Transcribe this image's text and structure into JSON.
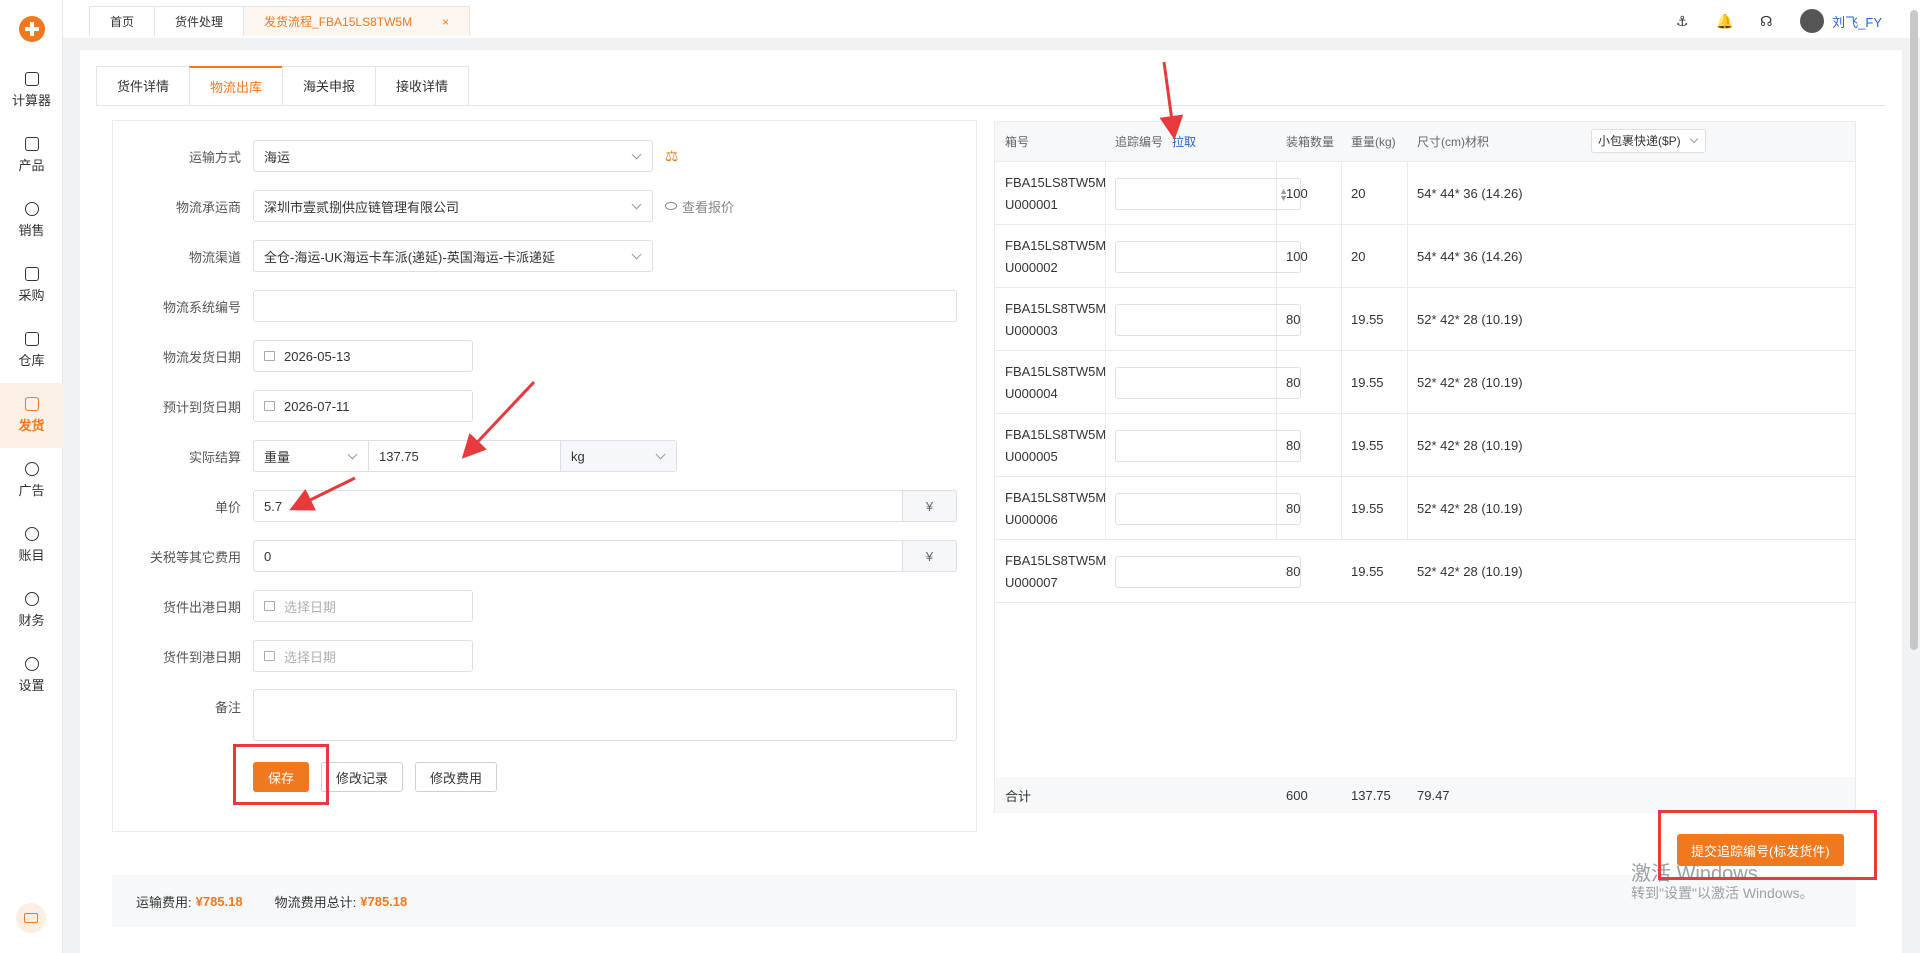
{
  "sidebar": {
    "items": [
      {
        "label": "计算器",
        "icon": "calculator-icon"
      },
      {
        "label": "产品",
        "icon": "inbox-icon"
      },
      {
        "label": "销售",
        "icon": "chart-icon"
      },
      {
        "label": "采购",
        "icon": "basket-icon"
      },
      {
        "label": "仓库",
        "icon": "warehouse-icon"
      },
      {
        "label": "发货",
        "icon": "person-ship-icon"
      },
      {
        "label": "广告",
        "icon": "ad-icon"
      },
      {
        "label": "账目",
        "icon": "yen-icon"
      },
      {
        "label": "财务",
        "icon": "yen-circle-icon"
      },
      {
        "label": "设置",
        "icon": "gear-icon"
      }
    ],
    "active": "发货"
  },
  "top_tabs": [
    {
      "label": "首页"
    },
    {
      "label": "货件处理"
    },
    {
      "label": "发货流程_FBA15LS8TW5M",
      "close": "×"
    }
  ],
  "user": {
    "name": "刘飞_FY"
  },
  "sub_tabs": [
    "货件详情",
    "物流出库",
    "海关申报",
    "接收详情"
  ],
  "form": {
    "transport_label": "运输方式",
    "transport_value": "海运",
    "carrier_label": "物流承运商",
    "carrier_value": "深圳市壹贰捌供应链管理有限公司",
    "carrier_link": "查看报价",
    "channel_label": "物流渠道",
    "channel_value": "全仓-海运-UK海运卡车派(递延)-英国海运-卡派递延",
    "sysno_label": "物流系统编号",
    "sysno_value": "",
    "ship_date_label": "物流发货日期",
    "ship_date_value": "2026-05-13",
    "eta_label": "预计到货日期",
    "eta_value": "2026-07-11",
    "settle_label": "实际结算",
    "settle_type": "重量",
    "settle_value": "137.75",
    "settle_unit": "kg",
    "price_label": "单价",
    "price_value": "5.7",
    "currency": "¥",
    "tax_label": "关税等其它费用",
    "tax_value": "0",
    "depart_label": "货件出港日期",
    "arrive_label": "货件到港日期",
    "date_placeholder": "选择日期",
    "remark_label": "备注",
    "save_btn": "保存",
    "history_btn": "修改记录",
    "edit_fee_btn": "修改费用"
  },
  "table": {
    "headers": {
      "box": "箱号",
      "track": "追踪编号",
      "pull": "拉取",
      "qty": "装箱数量",
      "weight": "重量(kg)",
      "size": "尺寸(cm)材积"
    },
    "size_select": "小包裹快递($P)",
    "rows": [
      {
        "box1": "FBA15LS8TW5M",
        "box2": "U000001",
        "qty": "100",
        "weight": "20",
        "size": "54* 44* 36 (14.26)"
      },
      {
        "box1": "FBA15LS8TW5M",
        "box2": "U000002",
        "qty": "100",
        "weight": "20",
        "size": "54* 44* 36 (14.26)"
      },
      {
        "box1": "FBA15LS8TW5M",
        "box2": "U000003",
        "qty": "80",
        "weight": "19.55",
        "size": "52* 42* 28 (10.19)"
      },
      {
        "box1": "FBA15LS8TW5M",
        "box2": "U000004",
        "qty": "80",
        "weight": "19.55",
        "size": "52* 42* 28 (10.19)"
      },
      {
        "box1": "FBA15LS8TW5M",
        "box2": "U000005",
        "qty": "80",
        "weight": "19.55",
        "size": "52* 42* 28 (10.19)"
      },
      {
        "box1": "FBA15LS8TW5M",
        "box2": "U000006",
        "qty": "80",
        "weight": "19.55",
        "size": "52* 42* 28 (10.19)"
      },
      {
        "box1": "FBA15LS8TW5M",
        "box2": "U000007",
        "qty": "80",
        "weight": "19.55",
        "size": "52* 42* 28 (10.19)"
      }
    ],
    "total_label": "合计",
    "total_qty": "600",
    "total_weight": "137.75",
    "total_volume": "79.47"
  },
  "submit_btn": "提交追踪编号(标发货件)",
  "footer": {
    "freight_label": "运输费用:",
    "freight_value": "¥785.18",
    "total_label": "物流费用总计:",
    "total_value": "¥785.18"
  },
  "watermark": {
    "line1": "激活 Windows",
    "line2": "转到\"设置\"以激活 Windows。"
  },
  "colors": {
    "accent": "#f0781e",
    "annotation": "#e8393d",
    "link": "#2b5fd9"
  }
}
